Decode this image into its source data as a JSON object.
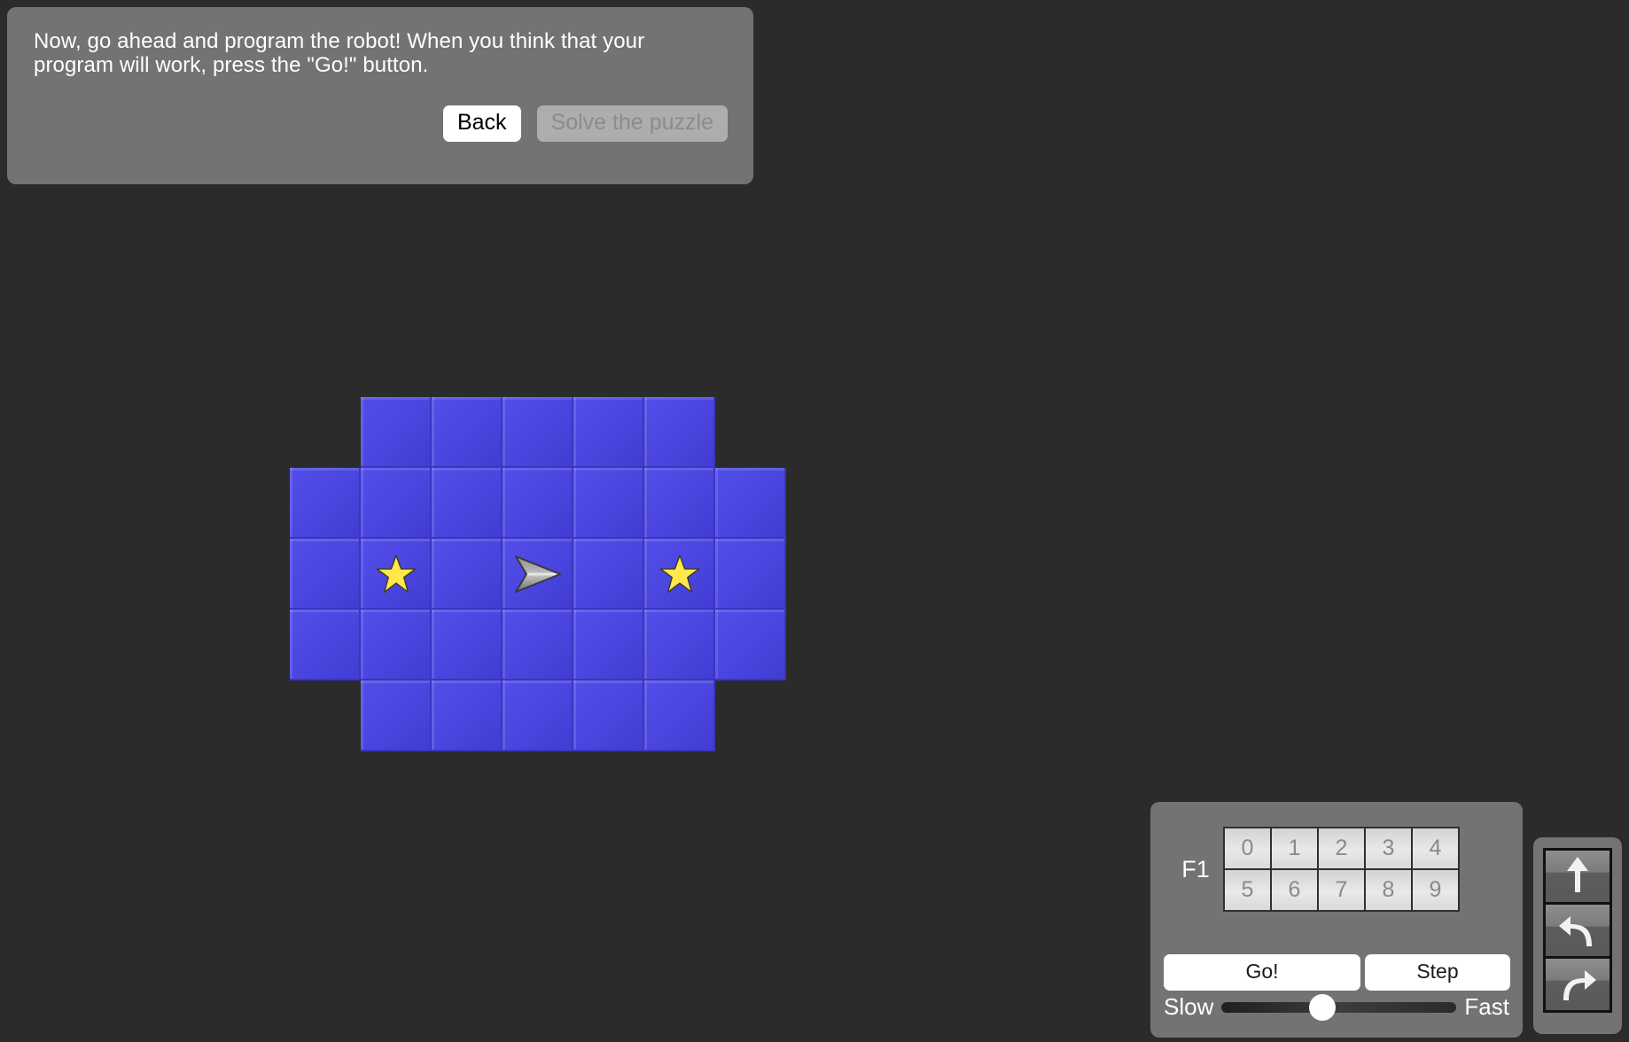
{
  "background_color": "#2b2b2b",
  "dialog": {
    "message": "Now, go ahead and program the robot! When you think that your\nprogram will work, press the \"Go!\" button.",
    "back_label": "Back",
    "solve_label": "Solve the puzzle",
    "panel_color": "#737373"
  },
  "board": {
    "rows": 5,
    "cols": 7,
    "cell_size": 80,
    "tile_color": "#4a45de",
    "shape": [
      [
        0,
        1,
        1,
        1,
        1,
        1,
        0
      ],
      [
        1,
        1,
        1,
        1,
        1,
        1,
        1
      ],
      [
        1,
        1,
        1,
        1,
        1,
        1,
        1
      ],
      [
        1,
        1,
        1,
        1,
        1,
        1,
        1
      ],
      [
        0,
        1,
        1,
        1,
        1,
        1,
        0
      ]
    ],
    "stars": [
      {
        "col": 1,
        "row": 2,
        "color": "#ffe84d"
      },
      {
        "col": 5,
        "row": 2,
        "color": "#ffe84d"
      }
    ],
    "robot": {
      "col": 3,
      "row": 2,
      "facing": "east",
      "icon": "robot-arrow-icon"
    }
  },
  "control_panel": {
    "function_label": "F1",
    "slots": [
      "0",
      "1",
      "2",
      "3",
      "4",
      "5",
      "6",
      "7",
      "8",
      "9"
    ],
    "go_label": "Go!",
    "step_label": "Step",
    "speed_slow_label": "Slow",
    "speed_fast_label": "Fast",
    "speed_value_percent": 43
  },
  "command_panel": {
    "commands": [
      {
        "name": "move-forward",
        "icon": "arrow-up-icon"
      },
      {
        "name": "turn-left",
        "icon": "turn-left-arrow-icon"
      },
      {
        "name": "turn-right",
        "icon": "turn-right-arrow-icon"
      }
    ]
  }
}
